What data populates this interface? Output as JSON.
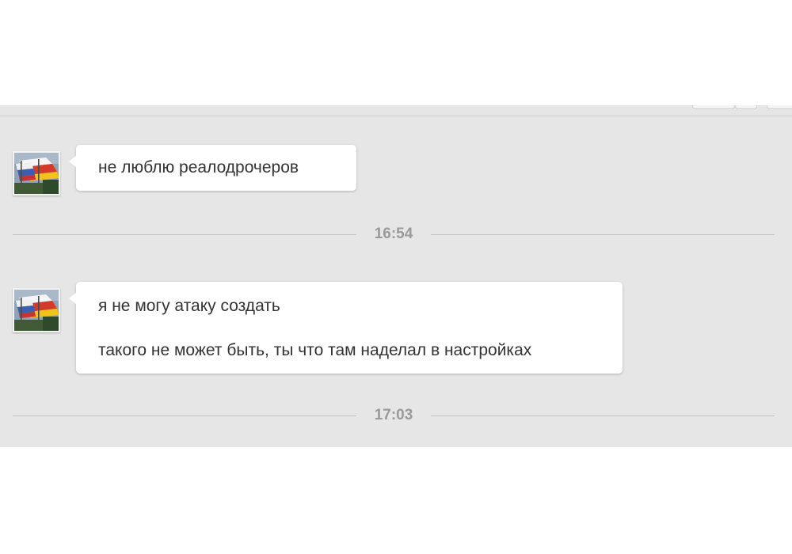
{
  "messages": [
    {
      "lines": [
        "не люблю реалодрочеров"
      ]
    },
    {
      "lines": [
        "я не могу атаку создать",
        "такого не может быть, ты что там наделал в настройках"
      ]
    }
  ],
  "timestamps": [
    "16:54",
    "17:03"
  ],
  "colors": {
    "chat_background": "#e6e6e6",
    "bubble_background": "#ffffff",
    "message_text": "#333333",
    "timestamp_text": "#9a9a9a",
    "separator_line": "#c3c3c3"
  },
  "icons": {
    "avatar": "flag-avatar-icon"
  }
}
